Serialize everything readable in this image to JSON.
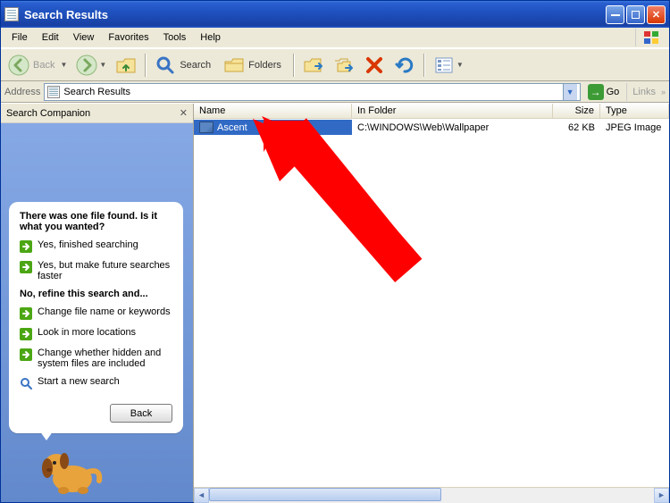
{
  "title": "Search Results",
  "menus": [
    "File",
    "Edit",
    "View",
    "Favorites",
    "Tools",
    "Help"
  ],
  "toolbar": {
    "back": "Back",
    "search": "Search",
    "folders": "Folders"
  },
  "address": {
    "label": "Address",
    "value": "Search Results",
    "go": "Go",
    "links": "Links"
  },
  "sidepane": {
    "title": "Search Companion",
    "question": "There was one file found.  Is it what you wanted?",
    "yes1": "Yes, finished searching",
    "yes2": "Yes, but make future searches faster",
    "refine_header": "No, refine this search and...",
    "opt1": "Change file name or keywords",
    "opt2": "Look in more locations",
    "opt3": "Change whether hidden and system files are included",
    "newsearch": "Start a new search",
    "back": "Back"
  },
  "columns": {
    "name": "Name",
    "folder": "In Folder",
    "size": "Size",
    "type": "Type"
  },
  "result": {
    "name": "Ascent",
    "folder": "C:\\WINDOWS\\Web\\Wallpaper",
    "size": "62 KB",
    "type": "JPEG Image"
  }
}
